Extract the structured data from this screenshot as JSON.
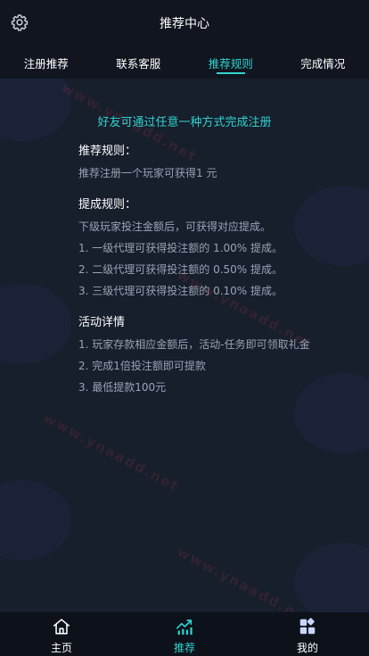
{
  "header": {
    "title": "推荐中心",
    "settings_icon": "gear-icon"
  },
  "tabs": [
    {
      "label": "注册推荐",
      "active": false
    },
    {
      "label": "联系客服",
      "active": false
    },
    {
      "label": "推荐规则",
      "active": true
    },
    {
      "label": "完成情况",
      "active": false
    }
  ],
  "content": {
    "intro": "好友可通过任意一种方式完成注册",
    "recommend_rules": {
      "title": "推荐规则：",
      "lines": [
        "推荐注册一个玩家可获得1 元"
      ]
    },
    "commission_rules": {
      "title": "提成规则：",
      "lines": [
        "下级玩家投注金额后，可获得对应提成。",
        "1. 一级代理可获得投注额的 1.00% 提成。",
        "2. 二级代理可获得投注额的 0.50% 提成。",
        "3. 三级代理可获得投注额的 0.10% 提成。"
      ]
    },
    "activity_details": {
      "title": "活动详情",
      "lines": [
        "1. 玩家存款相应金额后，活动-任务即可领取礼金",
        "2. 完成1倍投注额即可提款",
        "3. 最低提款100元"
      ]
    }
  },
  "bottom_nav": [
    {
      "label": "主页",
      "icon": "home-icon",
      "active": false
    },
    {
      "label": "推荐",
      "icon": "trend-chart-icon",
      "active": true
    },
    {
      "label": "我的",
      "icon": "grid-icon",
      "active": false
    }
  ],
  "colors": {
    "accent": "#2fd3d0",
    "background": "#171e2c",
    "header": "#10151f",
    "bottom_nav": "#0d111a"
  }
}
